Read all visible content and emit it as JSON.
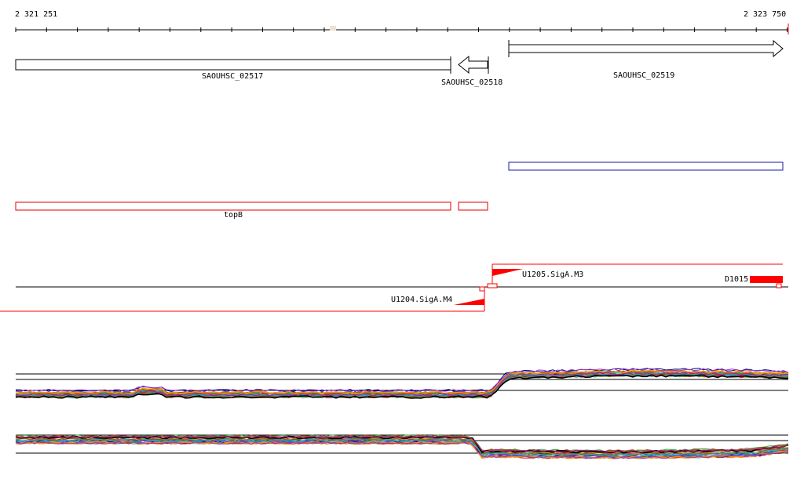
{
  "ruler": {
    "start_label": "2 321 251",
    "end_label": "2 323 750"
  },
  "genes": [
    {
      "label": "SAOUHSC_02517",
      "strand": "none"
    },
    {
      "label": "SAOUHSC_02518",
      "strand": "minus"
    },
    {
      "label": "SAOUHSC_02519",
      "strand": "plus"
    }
  ],
  "annotations": [
    {
      "label": "topB",
      "color": "#e00000"
    },
    {
      "label": "",
      "color": "#1a1aa0"
    }
  ],
  "promoters": [
    {
      "label": "U1204.SigA.M4",
      "strand": "minus",
      "color": "#ff0000"
    },
    {
      "label": "U1205.SigA.M3",
      "strand": "plus",
      "color": "#ff0000"
    },
    {
      "label": "D1015",
      "strand": "plus",
      "color": "#ff0000"
    }
  ],
  "colors": {
    "accent_red": "#ff0000",
    "track_line": "#000000",
    "ruler_marker": "#f4e0d0"
  },
  "expression_series_colors": [
    "#e6194b",
    "#3cb44b",
    "#4363d8",
    "#f58231",
    "#911eb4",
    "#46c0c0",
    "#d0c020",
    "#f032e6",
    "#8a6d3b",
    "#2e8b57",
    "#000080",
    "#808000",
    "#a0522d",
    "#556b2f",
    "#b22222",
    "#1e90ff",
    "#ff8c00",
    "#6b8e23",
    "#9932cc",
    "#20b2aa",
    "#000000",
    "#c71585"
  ]
}
